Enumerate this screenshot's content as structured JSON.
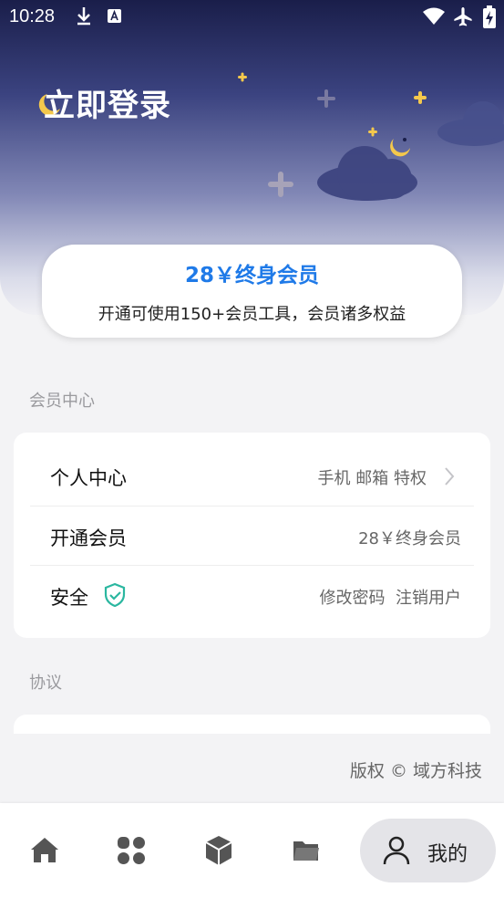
{
  "status_bar": {
    "time": "10:28"
  },
  "header": {
    "login_label": "立即登录"
  },
  "membership_card": {
    "title": "28￥终身会员",
    "description": "开通可使用150+会员工具，会员诸多权益"
  },
  "sections": {
    "member_center_label": "会员中心",
    "agreement_label": "协议"
  },
  "member_center": {
    "rows": [
      {
        "title": "个人中心",
        "value": "手机 邮箱 特权"
      },
      {
        "title": "开通会员",
        "value": "28￥终身会员"
      },
      {
        "title": "安全",
        "value": "修改密码  注销用户"
      }
    ]
  },
  "footer": {
    "copyright": "版权 © 域方科技"
  },
  "tabbar": {
    "active_label": "我的"
  },
  "colors": {
    "accent": "#1f7ae8",
    "shield": "#2bb7a0",
    "hero_top": "#1a1e4a"
  }
}
